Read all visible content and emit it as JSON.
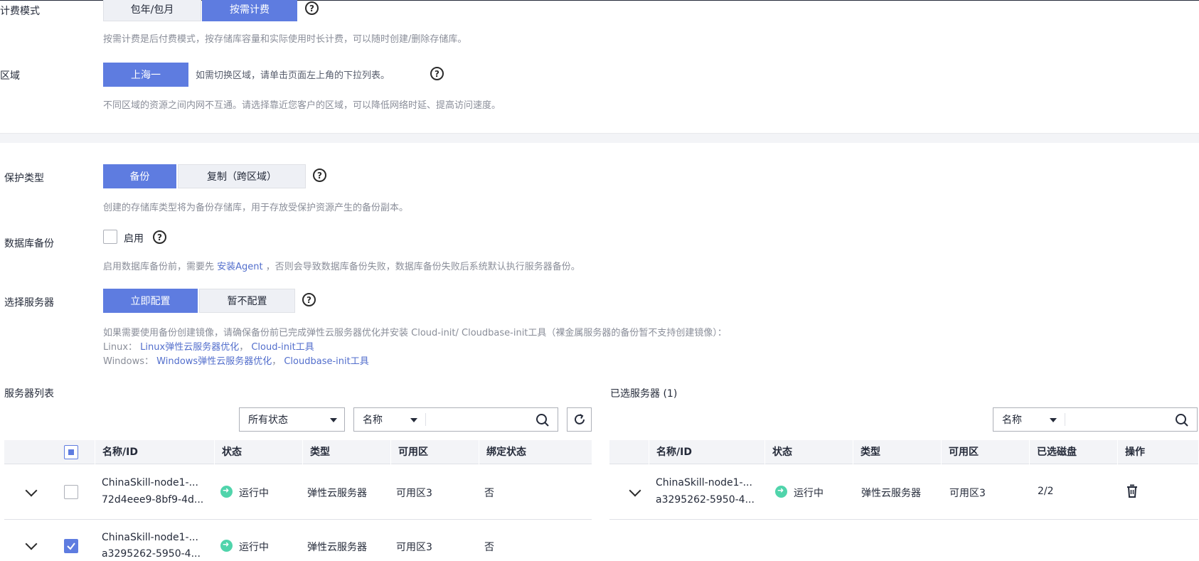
{
  "billing": {
    "label": "计费模式",
    "options": [
      "包年/包月",
      "按需计费"
    ],
    "hint": "按需计费是后付费模式，按存储库容量和实际使用时长计费，可以随时创建/删除存储库。"
  },
  "region": {
    "label": "区域",
    "value": "上海一",
    "inline_hint": "如需切换区域，请单击页面左上角的下拉列表。",
    "hint": "不同区域的资源之间内网不互通。请选择靠近您客户的区域，可以降低网络时延、提高访问速度。"
  },
  "protection": {
    "label": "保护类型",
    "options": [
      "备份",
      "复制（跨区域）"
    ],
    "hint": "创建的存储库类型将为备份存储库，用于存放受保护资源产生的备份副本。"
  },
  "db_backup": {
    "label": "数据库备份",
    "checkbox_label": "启用",
    "hint_prefix": "启用数据库备份前，需要先",
    "hint_link": "安装Agent",
    "hint_suffix": "，否则会导致数据库备份失败，数据库备份失败后系统默认执行服务器备份。"
  },
  "server_select": {
    "label": "选择服务器",
    "options": [
      "立即配置",
      "暂不配置"
    ],
    "hint_line1": "如果需要使用备份创建镜像，请确保备份前已完成弹性云服务器优化并安装 Cloud-init/ Cloudbase-init工具（裸金属服务器的备份暂不支持创建镜像）：",
    "linux_prefix": "Linux：",
    "linux_link1": "Linux弹性云服务器优化",
    "linux_link2": "Cloud-init工具",
    "windows_prefix": "Windows：",
    "windows_link1": "Windows弹性云服务器优化",
    "windows_link2": "Cloudbase-init工具",
    "separator": "，"
  },
  "server_list": {
    "title": "服务器列表",
    "status_filter": "所有状态",
    "search_field": "名称",
    "search_placeholder": "",
    "columns": [
      "名称/ID",
      "状态",
      "类型",
      "可用区",
      "绑定状态"
    ],
    "rows": [
      {
        "name": "ChinaSkill-node1-...",
        "id": "72d4eee9-8bf9-4d...",
        "status": "运行中",
        "type": "弹性云服务器",
        "zone": "可用区3",
        "bound": "否",
        "checked": false
      },
      {
        "name": "ChinaSkill-node1-...",
        "id": "a3295262-5950-4...",
        "status": "运行中",
        "type": "弹性云服务器",
        "zone": "可用区3",
        "bound": "否",
        "checked": true
      }
    ]
  },
  "selected_servers": {
    "title": "已选服务器 (1)",
    "search_field": "名称",
    "search_placeholder": "",
    "columns": [
      "名称/ID",
      "状态",
      "类型",
      "可用区",
      "已选磁盘",
      "操作"
    ],
    "rows": [
      {
        "name": "ChinaSkill-node1-...",
        "id": "a3295262-5950-4...",
        "status": "运行中",
        "type": "弹性云服务器",
        "zone": "可用区3",
        "disks": "2/2"
      }
    ]
  },
  "colors": {
    "accent": "#5e7ce0",
    "link": "#526ecc",
    "running": "#50d4ab"
  }
}
